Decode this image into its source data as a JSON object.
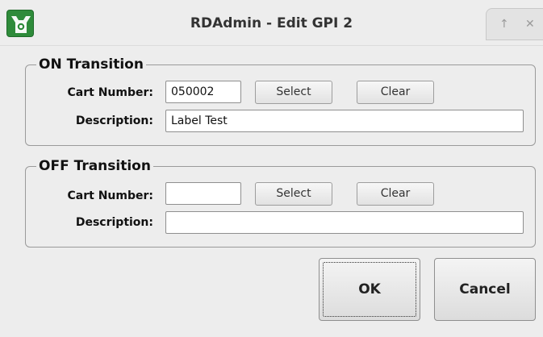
{
  "window": {
    "title": "RDAdmin - Edit GPI 2",
    "app_icon": "rivendell-app-icon",
    "controls": {
      "maximize_icon": "↑",
      "close_icon": "✕"
    }
  },
  "on_transition": {
    "group_title": "ON Transition",
    "cart_number_label": "Cart Number:",
    "cart_number_value": "050002",
    "select_label": "Select",
    "clear_label": "Clear",
    "description_label": "Description:",
    "description_value": "Label Test"
  },
  "off_transition": {
    "group_title": "OFF Transition",
    "cart_number_label": "Cart Number:",
    "cart_number_value": "",
    "select_label": "Select",
    "clear_label": "Clear",
    "description_label": "Description:",
    "description_value": ""
  },
  "actions": {
    "ok_label": "OK",
    "cancel_label": "Cancel"
  },
  "colors": {
    "background": "#ededed",
    "app_icon": "#2e8b3a"
  }
}
